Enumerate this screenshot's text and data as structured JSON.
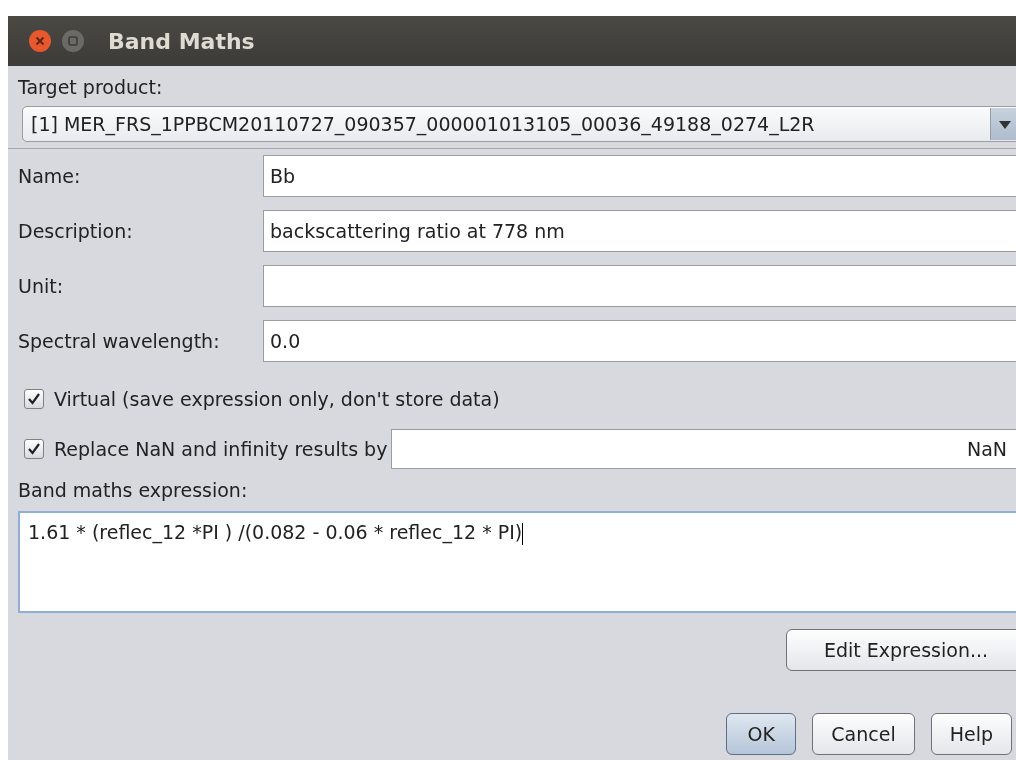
{
  "window": {
    "title": "Band Maths"
  },
  "target_product": {
    "label": "Target product:",
    "value": "[1] MER_FRS_1PPBCM20110727_090357_000001013105_00036_49188_0274_L2R"
  },
  "fields": [
    {
      "label": "Name:",
      "value": "Bb"
    },
    {
      "label": "Description:",
      "value": "backscattering ratio at 778 nm"
    },
    {
      "label": "Unit:"
    },
    {
      "label": "Spectral wavelength:",
      "value": "0.0"
    }
  ],
  "virtual": {
    "label": "Virtual (save expression only, don't store data)",
    "checked": true
  },
  "replace_nan": {
    "label": "Replace NaN and infinity results by",
    "checked": true,
    "value": "NaN"
  },
  "expression": {
    "label": "Band maths expression:",
    "value": "1.61 * (reflec_12 *PI ) /(0.082 - 0.06 * reflec_12 * PI)"
  },
  "edit_button": "Edit Expression...",
  "buttons": [
    {
      "label": "OK",
      "kind": "default"
    },
    {
      "label": "Cancel",
      "kind": "normal"
    },
    {
      "label": "Help",
      "kind": "normal"
    }
  ]
}
